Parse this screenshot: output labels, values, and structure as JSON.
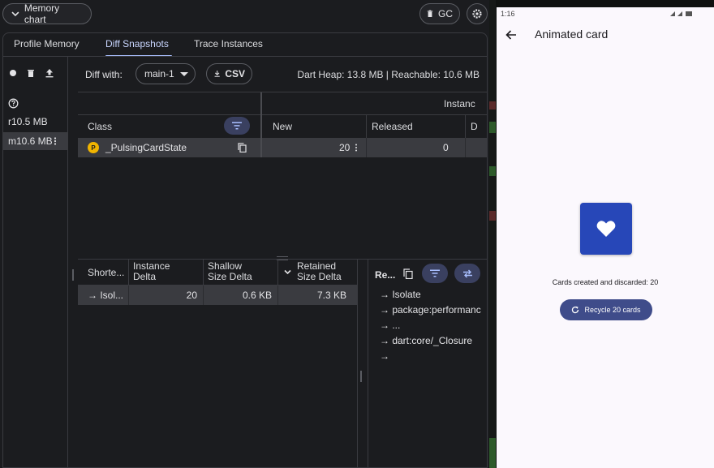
{
  "devtools": {
    "memory_chart_label": "Memory chart",
    "gc_label": "GC",
    "tabs": [
      {
        "label": "Profile Memory",
        "active": false
      },
      {
        "label": "Diff Snapshots",
        "active": true
      },
      {
        "label": "Trace Instances",
        "active": false
      }
    ],
    "snapshots": {
      "items": [
        {
          "label": "r10.5 MB",
          "selected": false
        },
        {
          "label": "m10.6 MB",
          "selected": true
        }
      ]
    },
    "diff": {
      "diff_with_label": "Diff with:",
      "diff_with_value": "main-1",
      "csv_label": "CSV",
      "heap_summary": "Dart Heap: 13.8 MB | Reachable: 10.6 MB",
      "group_header": "Instanc",
      "columns": {
        "class": "Class",
        "new": "New",
        "released": "Released",
        "delta": "D"
      },
      "rows": [
        {
          "badge": "P",
          "class_name": "_PulsingCardState",
          "new": "20",
          "released": "0"
        }
      ]
    },
    "retaining": {
      "columns": {
        "shortest": "Shorte...",
        "instance_delta_1": "Instance",
        "instance_delta_2": "Delta",
        "shallow_1": "Shallow",
        "shallow_2": "Size Delta",
        "retained_1": "Retained",
        "retained_2": "Size Delta"
      },
      "rows": [
        {
          "path": "→ Isol...",
          "instance_delta": "20",
          "shallow": "0.6 KB",
          "retained": "7.3 KB"
        }
      ],
      "panel_title": "Re...",
      "path_items": [
        "→ Isolate",
        "→ package:performanc",
        "→ ...",
        "→ dart:core/_Closure",
        "→"
      ]
    }
  },
  "phone": {
    "status_time": "1:16",
    "title": "Animated card",
    "counter_text": "Cards created and discarded: 20",
    "recycle_label": "Recycle 20 cards",
    "card_color": "#2747b8",
    "button_color": "#3f4c8a"
  },
  "icons": [
    "chevron-down-icon",
    "trash-icon",
    "gear-icon",
    "record-icon",
    "upload-icon",
    "help-icon",
    "more-vert-icon",
    "download-icon",
    "filter-icon",
    "copy-icon",
    "swap-icon",
    "back-arrow-icon",
    "heart-icon",
    "refresh-icon"
  ]
}
